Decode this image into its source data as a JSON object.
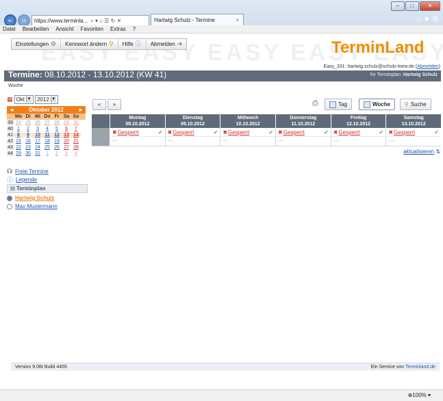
{
  "browser": {
    "address": "https://www.terminla...",
    "address_icons": "⌕ ▾ ⌂ ☰ ↻ ✕",
    "tab_title": "Hartwig Schulz - Termine",
    "tab_close": "×",
    "right_icons": "⌂ ★ ⚙",
    "minimize": "–",
    "maximize": "□",
    "close": "✕"
  },
  "menu": [
    "Datei",
    "Bearbeiten",
    "Ansicht",
    "Favoriten",
    "Extras",
    "?"
  ],
  "toolbar": {
    "settings": "Einstellungen",
    "password": "Kennwort ändern",
    "help": "Hilfe",
    "logout": "Abmelden",
    "bg_text": "EASY EASY EASY EASY EASY",
    "logo_termin": "Termin",
    "logo_land": "Land",
    "user_line": "Easy_331: hartwig.schulz@schulz-loew.de",
    "logout_link": "Abmelden"
  },
  "header": {
    "title_label": "Termine:",
    "title_range": "08.10.2012 - 13.10.2012 (KW 41)",
    "plan_label": "für Terminplan:",
    "plan_name": "Hartwig Schulz",
    "subtitle": "Woche"
  },
  "mini_calendar": {
    "month_select": "Okt",
    "year_select": "2012",
    "month_title": "Oktober 2012",
    "prev": "◄",
    "next": "►",
    "dow": [
      "Mo",
      "Di",
      "Mi",
      "Do",
      "Fr",
      "Sa",
      "So"
    ],
    "weeks": [
      {
        "wk": "39",
        "days": [
          "24",
          "25",
          "26",
          "27",
          "28",
          "29",
          "30"
        ]
      },
      {
        "wk": "40",
        "days": [
          "1",
          "2",
          "3",
          "4",
          "5",
          "6",
          "7"
        ]
      },
      {
        "wk": "41",
        "days": [
          "8",
          "9",
          "10",
          "11",
          "12",
          "13",
          "14"
        ]
      },
      {
        "wk": "42",
        "days": [
          "15",
          "16",
          "17",
          "18",
          "19",
          "20",
          "21"
        ]
      },
      {
        "wk": "43",
        "days": [
          "22",
          "23",
          "24",
          "25",
          "26",
          "27",
          "28"
        ]
      },
      {
        "wk": "44",
        "days": [
          "29",
          "30",
          "31",
          "1",
          "2",
          "3",
          "4"
        ]
      }
    ]
  },
  "side_links": {
    "free": "Freie Termine",
    "legend": "Legende"
  },
  "plan_box": {
    "title": "Terminplan",
    "items": [
      "Hartwig Schulz",
      "Max Mustermann"
    ]
  },
  "grid_toolbar": {
    "prev": "«",
    "next": "»",
    "print": "⎙",
    "day": "Tag",
    "week": "Woche",
    "search": "Suche"
  },
  "week_days": [
    {
      "name": "Montag",
      "date": "08.10.2012"
    },
    {
      "name": "Dienstag",
      "date": "09.10.2012"
    },
    {
      "name": "Mittwoch",
      "date": "10.10.2012"
    },
    {
      "name": "Donnerstag",
      "date": "11.10.2012"
    },
    {
      "name": "Freitag",
      "date": "12.10.2012"
    },
    {
      "name": "Samstag",
      "date": "13.10.2012"
    }
  ],
  "slot_label": "Gesperrt",
  "slot_empty": "---",
  "row_marker": "▼",
  "refresh": "aktualisieren",
  "footer": {
    "version": "Version 9.06t Build 4455",
    "service_prefix": "Ein Service von",
    "service_link": "Terminland.de"
  },
  "zoom": "⊕100%  ▾",
  "colors": {
    "accent_orange": "#f07f1a",
    "header_gray": "#5f6b7a",
    "link_blue": "#1f56b3",
    "blocked_red": "#d32f2f",
    "ok_green": "#4caf50"
  }
}
